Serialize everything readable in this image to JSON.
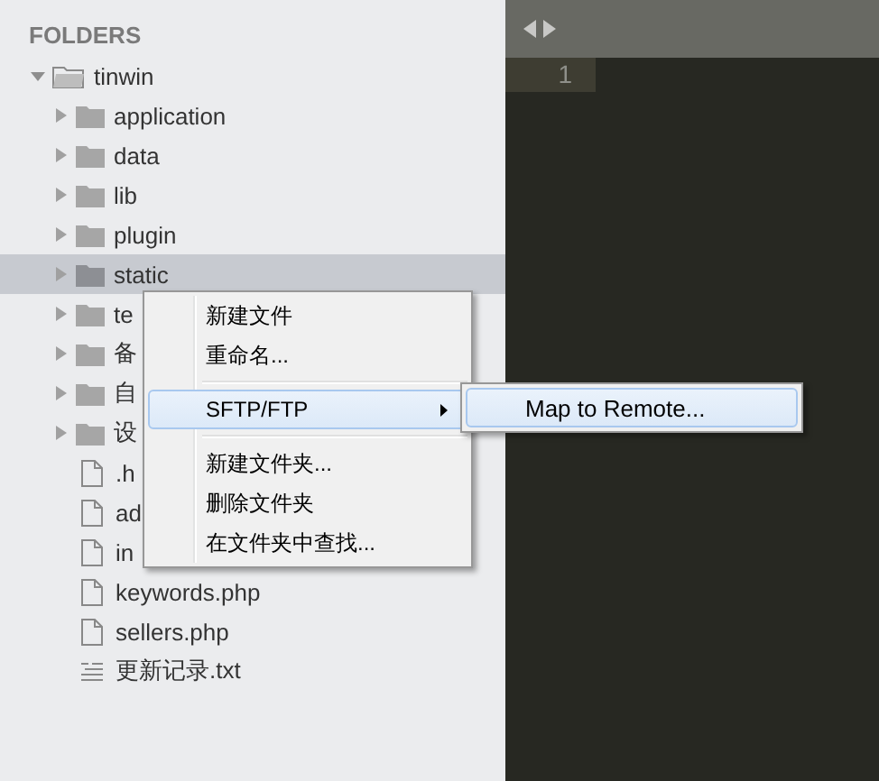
{
  "sidebar": {
    "title": "FOLDERS",
    "tree": {
      "label": "tinwin",
      "kind": "folder",
      "expanded": true,
      "selected": false,
      "children": [
        {
          "label": "application",
          "kind": "folder",
          "expanded": false,
          "selected": false
        },
        {
          "label": "data",
          "kind": "folder",
          "expanded": false,
          "selected": false
        },
        {
          "label": "lib",
          "kind": "folder",
          "expanded": false,
          "selected": false
        },
        {
          "label": "plugin",
          "kind": "folder",
          "expanded": false,
          "selected": false
        },
        {
          "label": "static",
          "kind": "folder",
          "expanded": false,
          "selected": true
        },
        {
          "label": "te",
          "kind": "folder",
          "expanded": false,
          "selected": false
        },
        {
          "label": "备",
          "kind": "folder",
          "expanded": false,
          "selected": false
        },
        {
          "label": "自",
          "kind": "folder",
          "expanded": false,
          "selected": false
        },
        {
          "label": "设",
          "kind": "folder",
          "expanded": false,
          "selected": false
        },
        {
          "label": ".h",
          "kind": "file",
          "selected": false
        },
        {
          "label": "ad",
          "kind": "file",
          "selected": false
        },
        {
          "label": "in",
          "kind": "file",
          "selected": false
        },
        {
          "label": "keywords.php",
          "kind": "file",
          "selected": false
        },
        {
          "label": "sellers.php",
          "kind": "file",
          "selected": false
        },
        {
          "label": "更新记录.txt",
          "kind": "text",
          "selected": false
        }
      ]
    }
  },
  "context_menu": {
    "items": [
      {
        "kind": "item",
        "label": "新建文件",
        "selected": false
      },
      {
        "kind": "item",
        "label": "重命名...",
        "selected": false
      },
      {
        "kind": "separator"
      },
      {
        "kind": "submenu",
        "label": "SFTP/FTP",
        "selected": true
      },
      {
        "kind": "separator"
      },
      {
        "kind": "item",
        "label": "新建文件夹...",
        "selected": false
      },
      {
        "kind": "item",
        "label": "删除文件夹",
        "selected": false
      },
      {
        "kind": "item",
        "label": "在文件夹中查找...",
        "selected": false
      }
    ]
  },
  "submenu": {
    "items": [
      {
        "label": "Map to Remote...",
        "selected": true
      }
    ]
  },
  "editor": {
    "line_numbers": [
      "1"
    ]
  }
}
